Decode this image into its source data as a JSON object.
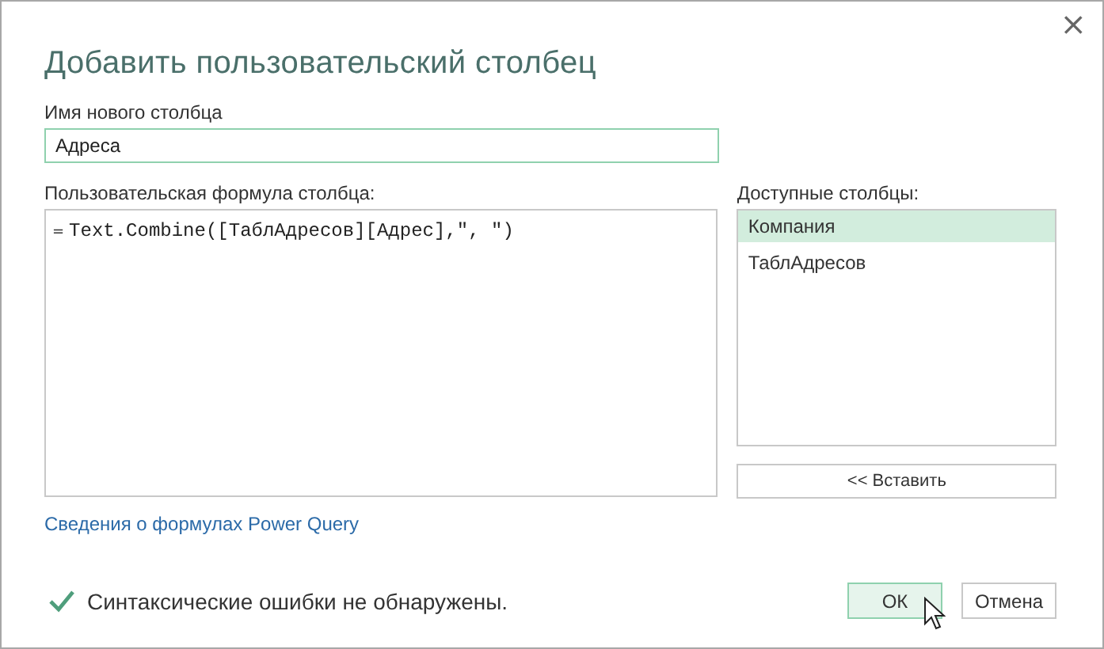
{
  "window": {
    "title": "Добавить пользовательский столбец",
    "close": "×"
  },
  "name_field": {
    "label": "Имя нового столбца",
    "value": "Адреса"
  },
  "formula": {
    "label": "Пользовательская формула столбца:",
    "prefix": "=",
    "value": "Text.Combine([ТаблАдресов][Адрес],\", \")"
  },
  "available_columns": {
    "label": "Доступные столбцы:",
    "items": [
      {
        "label": "Компания",
        "selected": true
      },
      {
        "label": "ТаблАдресов",
        "selected": false
      }
    ],
    "insert_button": "<< Вставить"
  },
  "help_link": "Сведения о формулах Power Query",
  "status": {
    "ok": true,
    "text": "Синтаксические ошибки не обнаружены."
  },
  "buttons": [
    {
      "label": "ОК",
      "kind": "primary"
    },
    {
      "label": "Отмена",
      "kind": "secondary"
    }
  ]
}
